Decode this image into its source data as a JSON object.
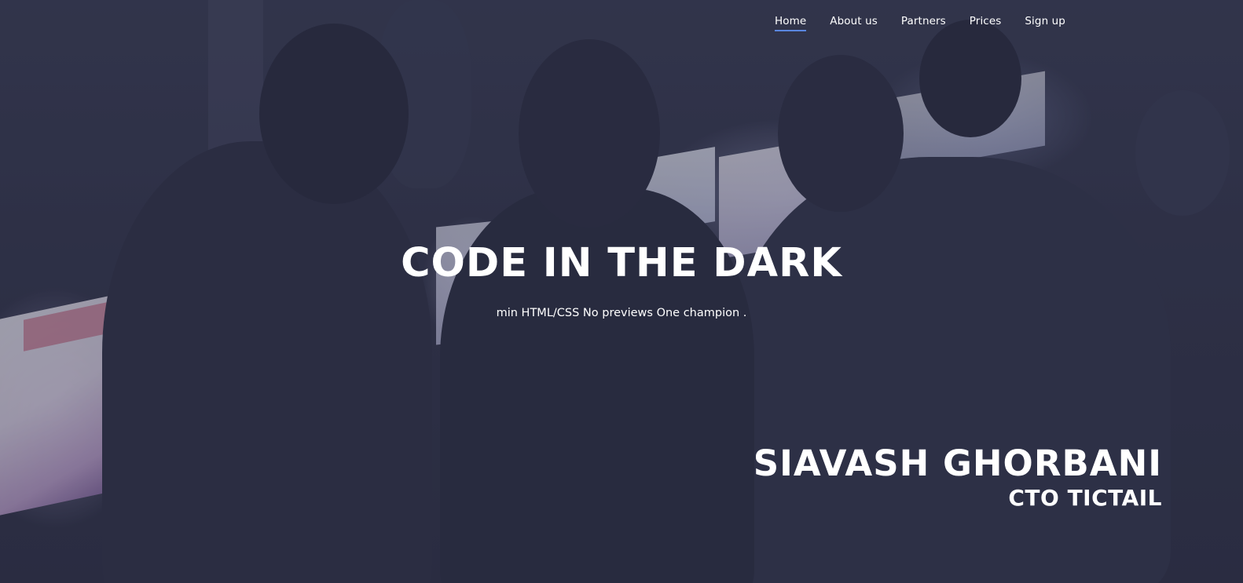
{
  "nav": {
    "items": [
      {
        "label": "Home",
        "active": true
      },
      {
        "label": "About us",
        "active": false
      },
      {
        "label": "Partners",
        "active": false
      },
      {
        "label": "Prices",
        "active": false
      },
      {
        "label": "Sign up",
        "active": false
      }
    ],
    "active_color": "#5a86e0"
  },
  "hero": {
    "title": "CODE IN THE DARK",
    "subtitle": "min HTML/CSS No previews One champion ."
  },
  "video_caption": {
    "name": "SIAVASH GHORBANI",
    "role": "CTO TICTAIL"
  }
}
